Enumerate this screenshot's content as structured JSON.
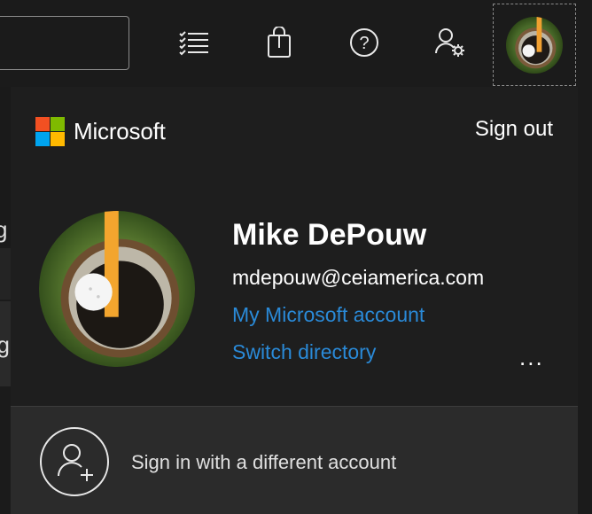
{
  "header": {
    "icons": [
      "checklist-icon",
      "shopping-bag-icon",
      "help-icon",
      "person-settings-icon"
    ]
  },
  "background_fragments": [
    "g",
    "ng"
  ],
  "panel": {
    "brand": "Microsoft",
    "brand_colors": [
      "#f25022",
      "#7fba00",
      "#00a4ef",
      "#ffb900"
    ],
    "sign_out_label": "Sign out",
    "user": {
      "name": "Mike DePouw",
      "email": "mdepouw@ceiamerica.com"
    },
    "links": {
      "my_account": "My Microsoft account",
      "switch_directory": "Switch directory"
    },
    "more_label": "...",
    "footer_label": "Sign in with a different account"
  },
  "colors": {
    "accent_link": "#2a8ad8",
    "panel_bg": "#1e1e1e",
    "footer_bg": "#2b2b2b"
  }
}
